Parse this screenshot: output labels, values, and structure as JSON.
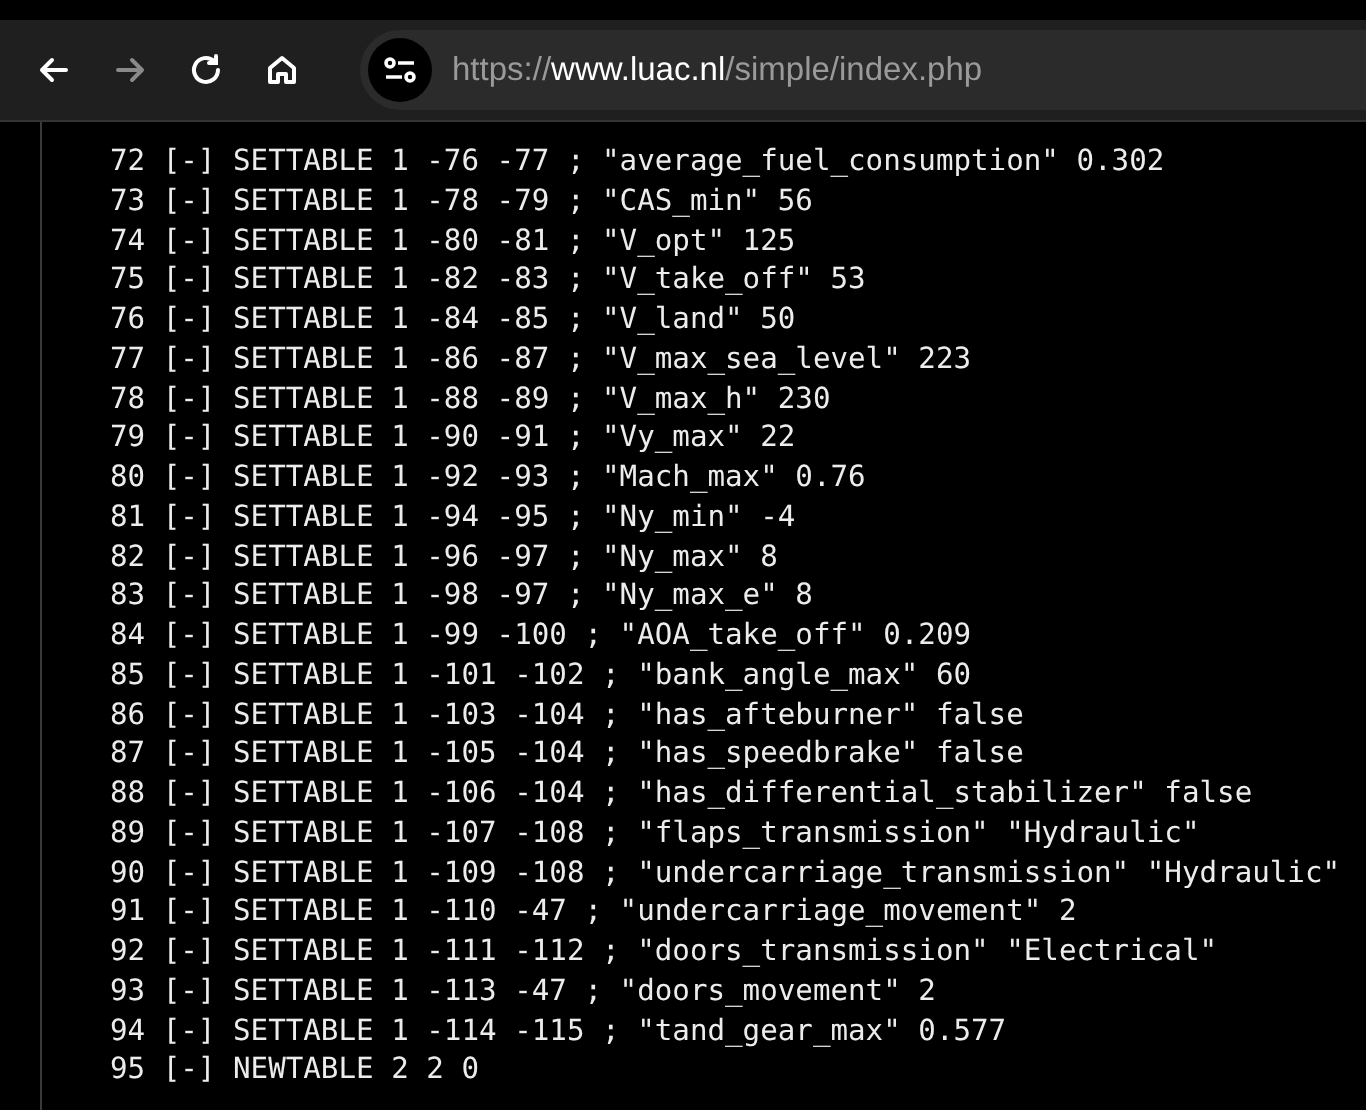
{
  "toolbar": {
    "back": {
      "disabled": false
    },
    "forward": {
      "disabled": true
    },
    "address": {
      "scheme": "https://",
      "host": "www.luac.nl",
      "path": "/simple/index.php"
    }
  },
  "lines": [
    "72 [-] SETTABLE 1 -76 -77 ; \"average_fuel_consumption\" 0.302",
    "73 [-] SETTABLE 1 -78 -79 ; \"CAS_min\" 56",
    "74 [-] SETTABLE 1 -80 -81 ; \"V_opt\" 125",
    "75 [-] SETTABLE 1 -82 -83 ; \"V_take_off\" 53",
    "76 [-] SETTABLE 1 -84 -85 ; \"V_land\" 50",
    "77 [-] SETTABLE 1 -86 -87 ; \"V_max_sea_level\" 223",
    "78 [-] SETTABLE 1 -88 -89 ; \"V_max_h\" 230",
    "79 [-] SETTABLE 1 -90 -91 ; \"Vy_max\" 22",
    "80 [-] SETTABLE 1 -92 -93 ; \"Mach_max\" 0.76",
    "81 [-] SETTABLE 1 -94 -95 ; \"Ny_min\" -4",
    "82 [-] SETTABLE 1 -96 -97 ; \"Ny_max\" 8",
    "83 [-] SETTABLE 1 -98 -97 ; \"Ny_max_e\" 8",
    "84 [-] SETTABLE 1 -99 -100 ; \"AOA_take_off\" 0.209",
    "85 [-] SETTABLE 1 -101 -102 ; \"bank_angle_max\" 60",
    "86 [-] SETTABLE 1 -103 -104 ; \"has_afteburner\" false",
    "87 [-] SETTABLE 1 -105 -104 ; \"has_speedbrake\" false",
    "88 [-] SETTABLE 1 -106 -104 ; \"has_differential_stabilizer\" false",
    "89 [-] SETTABLE 1 -107 -108 ; \"flaps_transmission\" \"Hydraulic\"",
    "90 [-] SETTABLE 1 -109 -108 ; \"undercarriage_transmission\" \"Hydraulic\"",
    "91 [-] SETTABLE 1 -110 -47 ; \"undercarriage_movement\" 2",
    "92 [-] SETTABLE 1 -111 -112 ; \"doors_transmission\" \"Electrical\"",
    "93 [-] SETTABLE 1 -113 -47 ; \"doors_movement\" 2",
    "94 [-] SETTABLE 1 -114 -115 ; \"tand_gear_max\" 0.577",
    "95 [-] NEWTABLE 2 2 0"
  ]
}
